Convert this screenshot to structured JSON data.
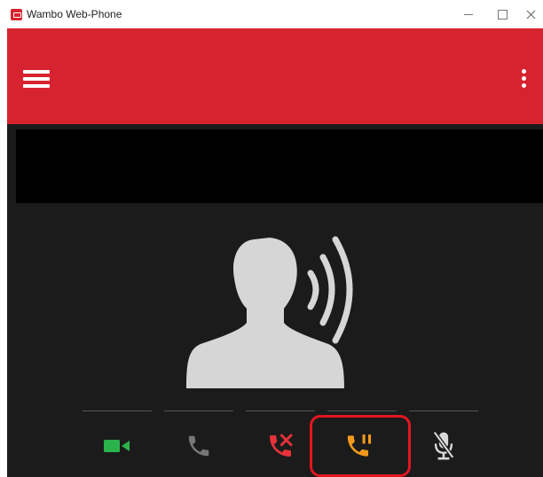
{
  "window": {
    "title": "Wambo Web-Phone",
    "controls": [
      "minimize",
      "maximize",
      "close"
    ]
  },
  "appbar": {
    "menu_icon": "hamburger-icon",
    "overflow_icon": "more-vert-icon",
    "color": "#d7232f"
  },
  "call": {
    "caller_info": "",
    "avatar_icon": "person-speaking-icon"
  },
  "actions": [
    {
      "name": "video",
      "icon": "video-camera-icon",
      "color": "#2bb34b"
    },
    {
      "name": "call",
      "icon": "phone-icon",
      "color": "#777777"
    },
    {
      "name": "hang-up",
      "icon": "phone-hangup-icon",
      "color": "#e53238"
    },
    {
      "name": "hold",
      "icon": "phone-hold-icon",
      "color": "#f39a1c",
      "highlighted": true
    },
    {
      "name": "mute",
      "icon": "mic-off-icon",
      "color": "#d9d9d9"
    }
  ],
  "colors": {
    "accent": "#d7232f",
    "background": "#1b1b1b",
    "highlight": "#e3161f"
  }
}
